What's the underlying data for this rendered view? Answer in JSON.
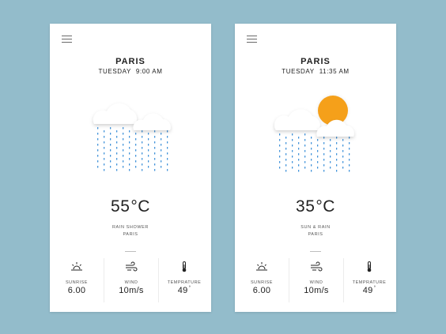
{
  "cards": [
    {
      "city": "PARIS",
      "day": "TUESDAY",
      "time": "9:00 AM",
      "temperature": "55",
      "temperature_unit": "°C",
      "condition": "RAIN SHOWER",
      "location": "PARIS",
      "weather_icon": "rain-cloud-icon",
      "stats": [
        {
          "label": "SUNRISE",
          "value": "6.00",
          "icon": "sunrise-icon"
        },
        {
          "label": "WIND",
          "value": "10m/s",
          "icon": "wind-icon"
        },
        {
          "label": "TEMPRATURE",
          "value": "49",
          "suffix": "°",
          "icon": "thermometer-icon"
        }
      ]
    },
    {
      "city": "PARIS",
      "day": "TUESDAY",
      "time": "11:35 AM",
      "temperature": "35",
      "temperature_unit": "°C",
      "condition": "SUN & RAIN",
      "location": "PARIS",
      "weather_icon": "sun-rain-cloud-icon",
      "stats": [
        {
          "label": "SUNRISE",
          "value": "6.00",
          "icon": "sunrise-icon"
        },
        {
          "label": "WIND",
          "value": "10m/s",
          "icon": "wind-icon"
        },
        {
          "label": "TEMPRATURE",
          "value": "49",
          "suffix": "°",
          "icon": "thermometer-icon"
        }
      ]
    }
  ],
  "colors": {
    "background": "#93bccb",
    "card": "#ffffff",
    "rain": "#3b8fd8",
    "sun": "#f5a01a",
    "cloud": "#ffffff"
  }
}
